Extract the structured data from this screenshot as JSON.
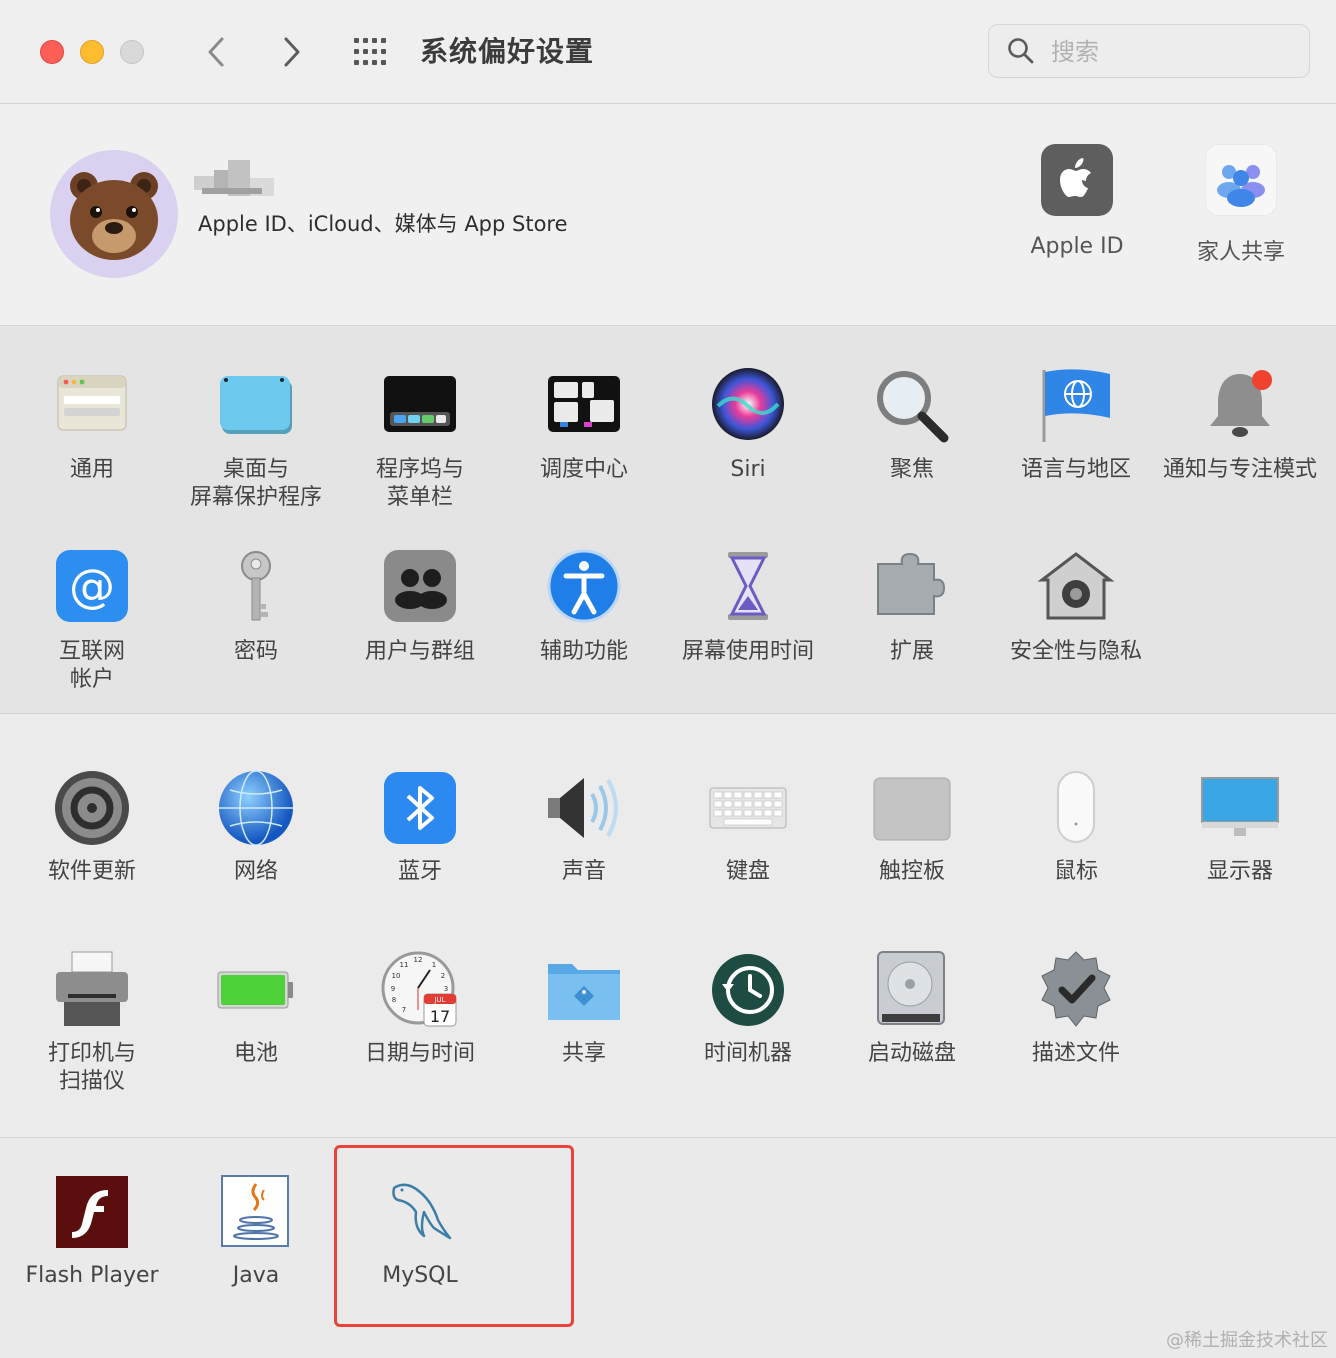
{
  "window": {
    "title": "系统偏好设置"
  },
  "search": {
    "placeholder": "搜索"
  },
  "account": {
    "subtitle": "Apple ID、iCloud、媒体与 App Store",
    "shortcuts": [
      {
        "label": "Apple ID",
        "icon": "apple-logo-icon"
      },
      {
        "label": "家人共享",
        "icon": "family-sharing-icon"
      }
    ]
  },
  "section1": [
    {
      "label": "通用",
      "icon": "general-icon"
    },
    {
      "label": "桌面与\n屏幕保护程序",
      "icon": "desktop-screensaver-icon"
    },
    {
      "label": "程序坞与\n菜单栏",
      "icon": "dock-menubar-icon"
    },
    {
      "label": "调度中心",
      "icon": "mission-control-icon"
    },
    {
      "label": "Siri",
      "icon": "siri-icon"
    },
    {
      "label": "聚焦",
      "icon": "spotlight-icon"
    },
    {
      "label": "语言与地区",
      "icon": "language-region-icon"
    },
    {
      "label": "通知与专注模式",
      "icon": "notifications-icon"
    },
    {
      "label": "互联网\n帐户",
      "icon": "internet-accounts-icon"
    },
    {
      "label": "密码",
      "icon": "passwords-key-icon"
    },
    {
      "label": "用户与群组",
      "icon": "users-groups-icon"
    },
    {
      "label": "辅助功能",
      "icon": "accessibility-icon"
    },
    {
      "label": "屏幕使用时间",
      "icon": "screen-time-hourglass-icon"
    },
    {
      "label": "扩展",
      "icon": "extensions-puzzle-icon"
    },
    {
      "label": "安全性与隐私",
      "icon": "security-privacy-icon"
    }
  ],
  "section2": [
    {
      "label": "软件更新",
      "icon": "software-update-gear-icon"
    },
    {
      "label": "网络",
      "icon": "network-globe-icon"
    },
    {
      "label": "蓝牙",
      "icon": "bluetooth-icon"
    },
    {
      "label": "声音",
      "icon": "sound-speaker-icon"
    },
    {
      "label": "键盘",
      "icon": "keyboard-icon"
    },
    {
      "label": "触控板",
      "icon": "trackpad-icon"
    },
    {
      "label": "鼠标",
      "icon": "mouse-icon"
    },
    {
      "label": "显示器",
      "icon": "displays-monitor-icon"
    },
    {
      "label": "打印机与\n扫描仪",
      "icon": "printer-icon"
    },
    {
      "label": "电池",
      "icon": "battery-icon"
    },
    {
      "label": "日期与时间",
      "icon": "date-time-clock-icon"
    },
    {
      "label": "共享",
      "icon": "sharing-folder-icon"
    },
    {
      "label": "时间机器",
      "icon": "time-machine-icon"
    },
    {
      "label": "启动磁盘",
      "icon": "startup-disk-icon"
    },
    {
      "label": "描述文件",
      "icon": "profiles-badge-icon"
    }
  ],
  "section3": [
    {
      "label": "Flash Player",
      "icon": "flash-player-icon"
    },
    {
      "label": "Java",
      "icon": "java-cup-icon"
    },
    {
      "label": "MySQL",
      "icon": "mysql-dolphin-icon"
    }
  ],
  "calendar": {
    "month": "JUL",
    "day": "17"
  },
  "watermark": "@稀土掘金技术社区",
  "colors": {
    "highlight": "#e8443a",
    "close": "#fd5f57",
    "minimize": "#febc2e"
  }
}
